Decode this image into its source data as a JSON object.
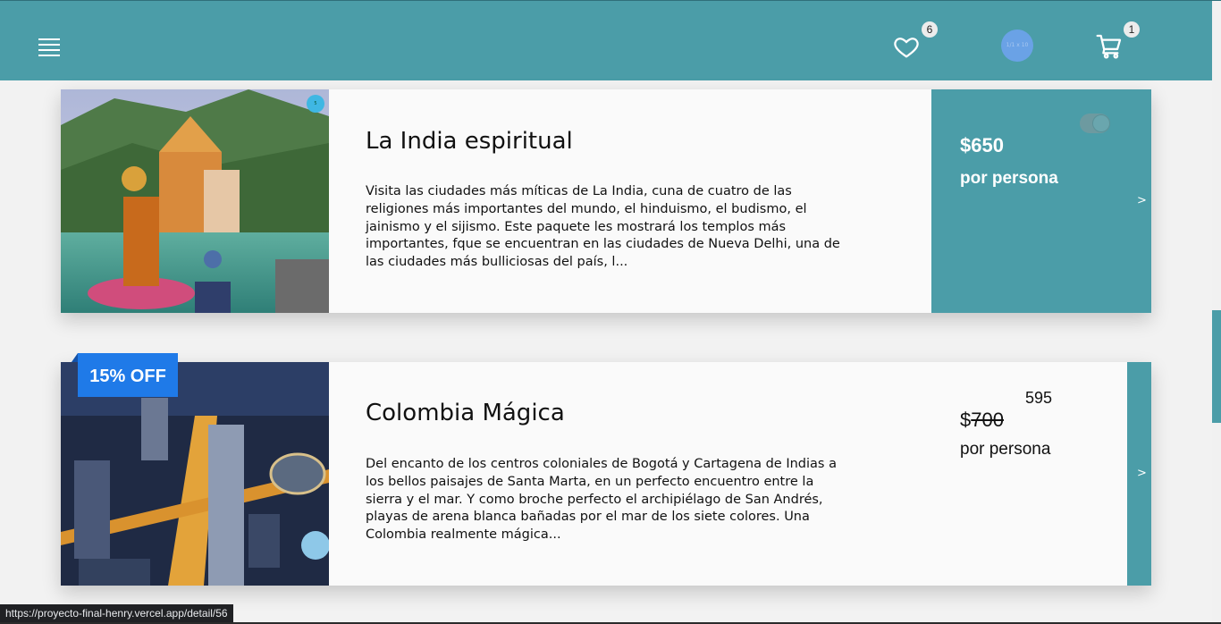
{
  "header": {
    "favorites_count": "6",
    "cart_count": "1",
    "avatar_text": "1/1 x 10",
    "menu_icon": "hamburger-icon",
    "favorites_icon": "heart-icon",
    "cart_icon": "cart-icon"
  },
  "packages": [
    {
      "title": "La India espiritual",
      "description": "Visita las ciudades más míticas de La India, cuna de cuatro de las religiones más importantes del mundo, el hinduismo, el budismo, el jainismo y el sijismo. Este paquete les mostrará los templos más importantes, fque se encuentran en las ciudades de Nueva Delhi, una de las ciudades más bulliciosas del país, l...",
      "price": "$650",
      "per_person": "por persona",
      "arrow": ">",
      "logo_text": "5"
    },
    {
      "title": "Colombia Mágica",
      "description": "Del encanto de los centros coloniales de Bogotá y Cartagena de Indias a los bellos paisajes de Santa Marta, en un perfecto encuentro entre la sierra y el mar. Y como broche perfecto el archipiélago de San Andrés, playas de arena blanca bañadas por el mar de los siete colores. Una Colombia realmente mágica...",
      "discount": "15% OFF",
      "price_currency": "$",
      "price_old": "700",
      "price_new": "595",
      "per_person": "por persona",
      "arrow": ">"
    }
  ],
  "status_bar": {
    "url": "https://proyecto-final-henry.vercel.app/detail/56"
  },
  "colors": {
    "accent": "#4b9da8",
    "discount": "#1f7ae8"
  }
}
